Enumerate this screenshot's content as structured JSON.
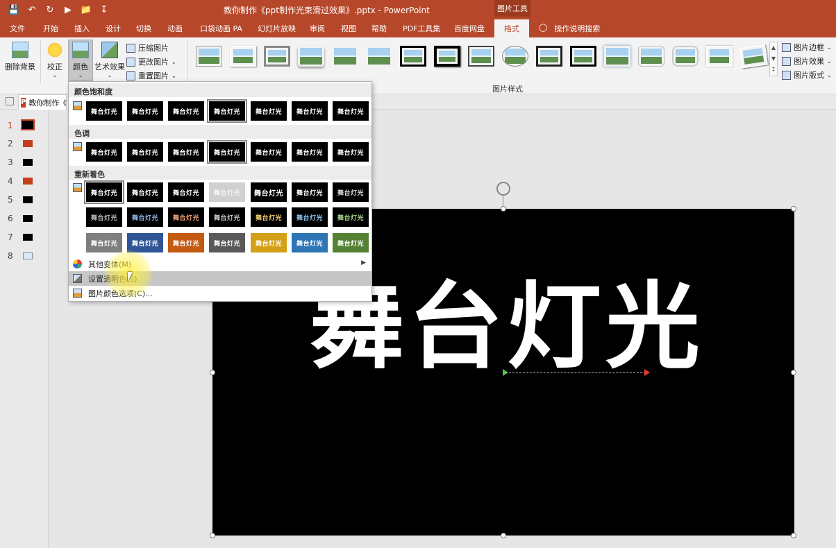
{
  "window": {
    "title": "教你制作《ppt制作光束滑过效果》.pptx - PowerPoint",
    "context_tool": "图片工具"
  },
  "qat": {
    "icons": [
      "save-icon",
      "undo-icon",
      "redo-icon",
      "slideshow-icon",
      "open-icon",
      "customize-icon"
    ]
  },
  "tabs": [
    "文件",
    "开始",
    "插入",
    "设计",
    "切换",
    "动画",
    "口袋动画 PA",
    "幻灯片放映",
    "审阅",
    "视图",
    "帮助",
    "PDF工具集",
    "百度网盘",
    "格式"
  ],
  "search": {
    "label": "操作说明搜索"
  },
  "ribbon": {
    "remove_bg": "删除背景",
    "corrections": "校正",
    "color": "颜色",
    "artistic": "艺术效果",
    "compress": "压缩图片",
    "change": "更改图片",
    "reset": "重置图片",
    "styles_group": "图片样式",
    "border": "图片边框",
    "effects": "图片效果",
    "layout": "图片版式"
  },
  "doc_tab": {
    "name": "教你制作《"
  },
  "slides": [
    {
      "num": "1"
    },
    {
      "num": "2"
    },
    {
      "num": "3"
    },
    {
      "num": "4"
    },
    {
      "num": "5"
    },
    {
      "num": "6"
    },
    {
      "num": "7"
    },
    {
      "num": "8"
    }
  ],
  "slide_text": "舞台灯光",
  "dropdown": {
    "saturation_header": "颜色饱和度",
    "tone_header": "色调",
    "recolor_header": "重新着色",
    "swatch_text": "舞台灯光",
    "more_variations": "其他变体(M)",
    "set_transparent": "设置透明色(S)",
    "color_options": "图片颜色选项(C)..."
  },
  "recolor_colors": {
    "row3": [
      "#7f7f7f",
      "#2f5597",
      "#c55a11",
      "#595959",
      "#d4a017",
      "#2e75b6",
      "#548235"
    ]
  },
  "accent": "#b7472a"
}
